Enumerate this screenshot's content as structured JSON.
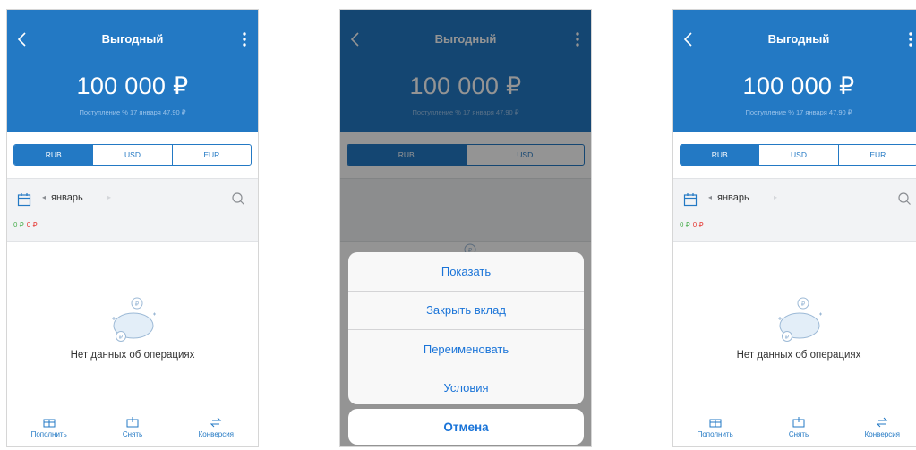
{
  "header": {
    "title": "Выгодный",
    "amount": "100 000 ₽",
    "subtitle": "Поступление % 17 января 47,90 ₽"
  },
  "currency_tabs": [
    "RUB",
    "USD",
    "EUR"
  ],
  "dialog_currency_tabs": [
    "RUB",
    "USD"
  ],
  "filter": {
    "month": "январь",
    "income": "0 ₽",
    "expense": "0 ₽"
  },
  "empty_state": {
    "text": "Нет данных об операциях"
  },
  "tabbar": {
    "topup": "Пополнить",
    "withdraw": "Снять",
    "convert": "Конверсия"
  },
  "action_sheet": {
    "items": [
      "Показать",
      "Закрыть вклад",
      "Переименовать",
      "Условия"
    ],
    "cancel": "Отмена"
  },
  "colors": {
    "brand_blue": "#2379c4",
    "income": "#4caf50",
    "expense": "#e53935",
    "action_blue": "#1a74d8"
  }
}
